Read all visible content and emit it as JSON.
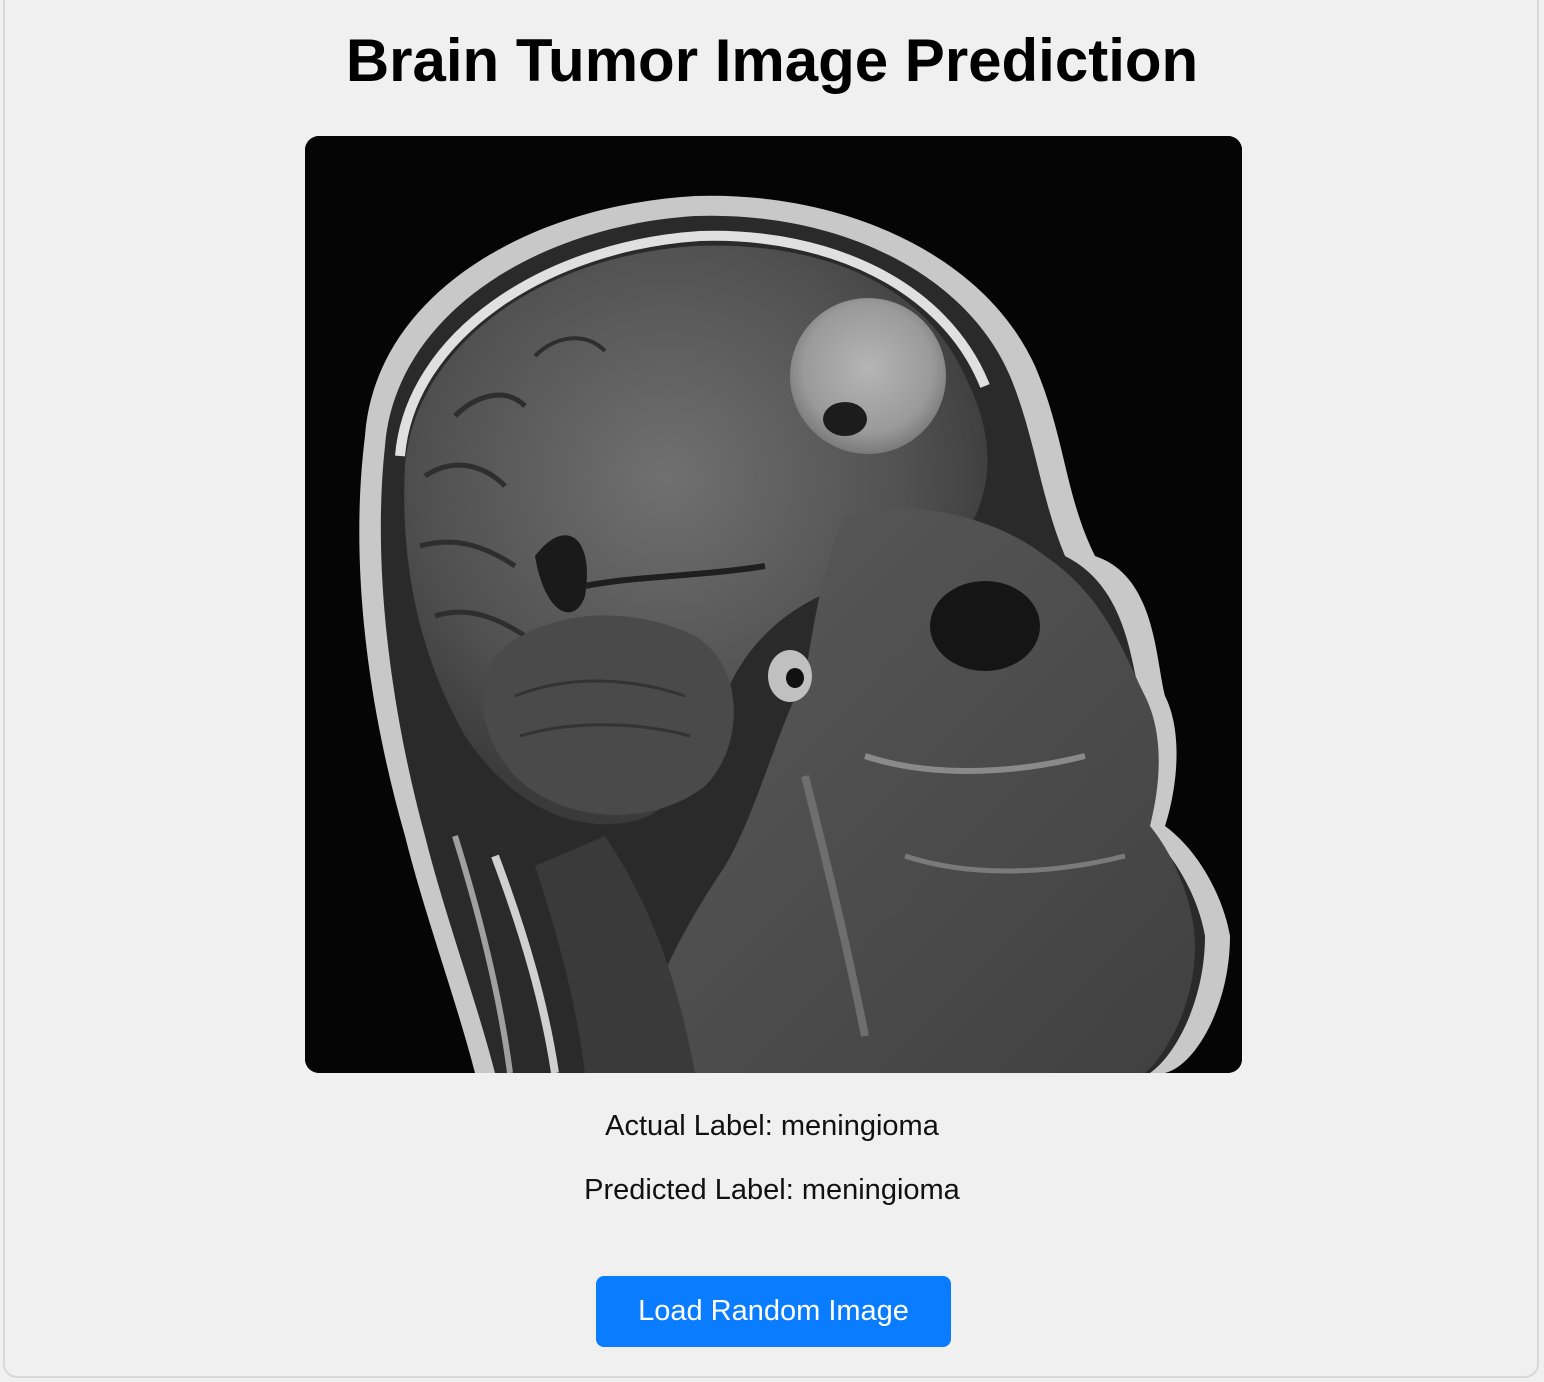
{
  "page": {
    "title": "Brain Tumor Image Prediction"
  },
  "image": {
    "semantic": "brain-mri-sagittal-scan",
    "description_alt": "MRI scan"
  },
  "labels": {
    "actual_prefix": "Actual Label: ",
    "actual_value": "meningioma",
    "predicted_prefix": "Predicted Label: ",
    "predicted_value": "meningioma"
  },
  "actions": {
    "load_button_label": "Load Random Image"
  },
  "colors": {
    "accent": "#0a7cff",
    "background": "#f0f0f0"
  }
}
